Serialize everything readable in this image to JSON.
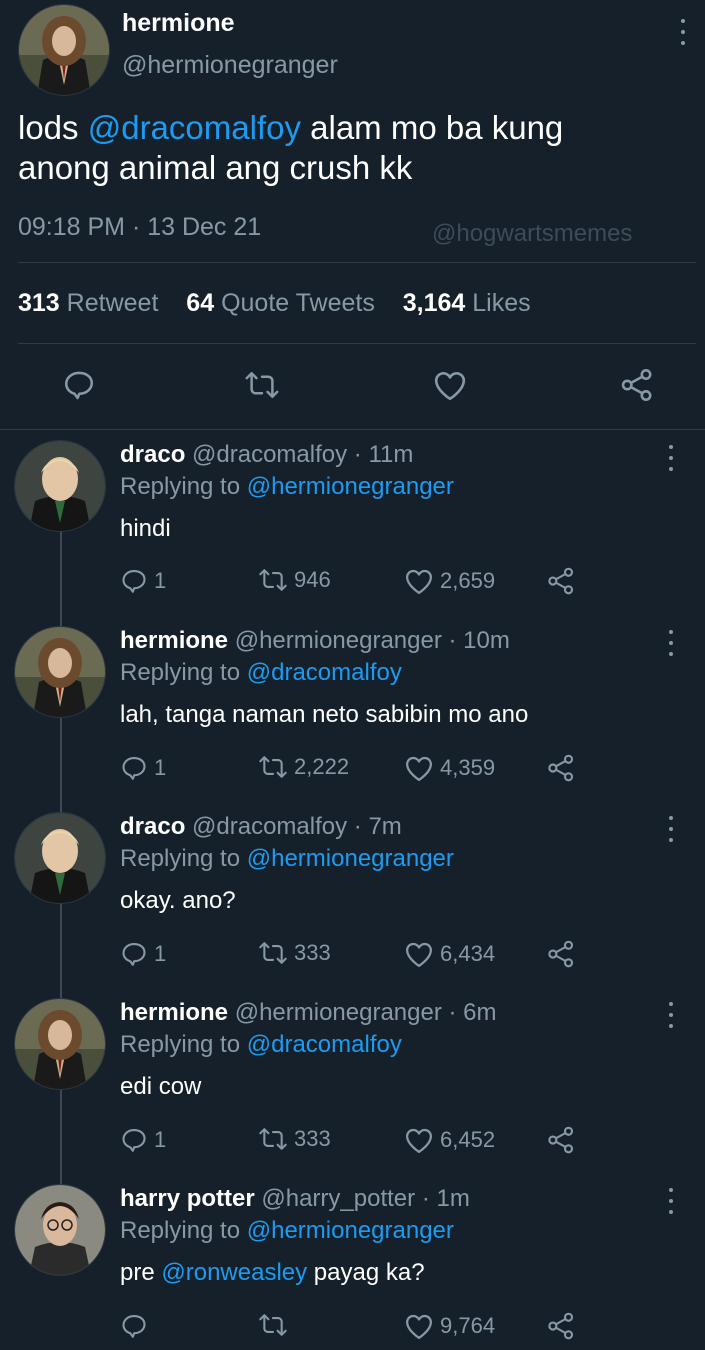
{
  "main_tweet": {
    "display_name": "hermione",
    "handle": "@hermionegranger",
    "text_prefix": "lods ",
    "mention": "@dracomalfoy",
    "text_line1_suffix": " alam mo ba kung",
    "text_line2": "anong animal ang crush kk",
    "timestamp": "09:18 PM · 13 Dec 21",
    "watermark": "@hogwartsmemes",
    "stats": {
      "retweets_count": "313",
      "retweets_label": "Retweet",
      "quotes_count": "64",
      "quotes_label": "Quote Tweets",
      "likes_count": "3,164",
      "likes_label": "Likes"
    },
    "actions": [
      "reply-icon",
      "retweet-icon",
      "like-icon",
      "share-icon"
    ]
  },
  "replies": [
    {
      "name": "draco",
      "handle": "@dracomalfoy",
      "time": "· 11m",
      "replying_label": "Replying to",
      "replying_to": "@hermionegranger",
      "text": "hindi",
      "reply_count": "1",
      "retweet_count": "946",
      "like_count": "2,659"
    },
    {
      "name": "hermione",
      "handle": "@hermionegranger",
      "time": "· 10m",
      "replying_label": "Replying to",
      "replying_to": "@dracomalfoy",
      "text": "lah, tanga naman neto sabibin mo ano",
      "reply_count": "1",
      "retweet_count": "2,222",
      "like_count": "4,359"
    },
    {
      "name": "draco",
      "handle": "@dracomalfoy",
      "time": "· 7m",
      "replying_label": "Replying to",
      "replying_to": "@hermionegranger",
      "text": "okay. ano?",
      "reply_count": "1",
      "retweet_count": "333",
      "like_count": "6,434"
    },
    {
      "name": "hermione",
      "handle": "@hermionegranger",
      "time": "· 6m",
      "replying_label": "Replying to",
      "replying_to": "@dracomalfoy",
      "text": "edi cow",
      "reply_count": "1",
      "retweet_count": "333",
      "like_count": "6,452"
    },
    {
      "name": "harry potter",
      "handle": "@harry_potter",
      "time": "· 1m",
      "replying_label": "Replying to",
      "replying_to": "@hermionegranger",
      "text_prefix": "pre ",
      "text_mention": "@ronweasley",
      "text_suffix": " payag ka?",
      "reply_count": "",
      "retweet_count": "",
      "like_count": "9,764"
    }
  ],
  "colors": {
    "background": "#15202b",
    "accent_blue": "#1d9bf0",
    "muted_grey": "#8899a6",
    "divider": "#2f3b47"
  }
}
